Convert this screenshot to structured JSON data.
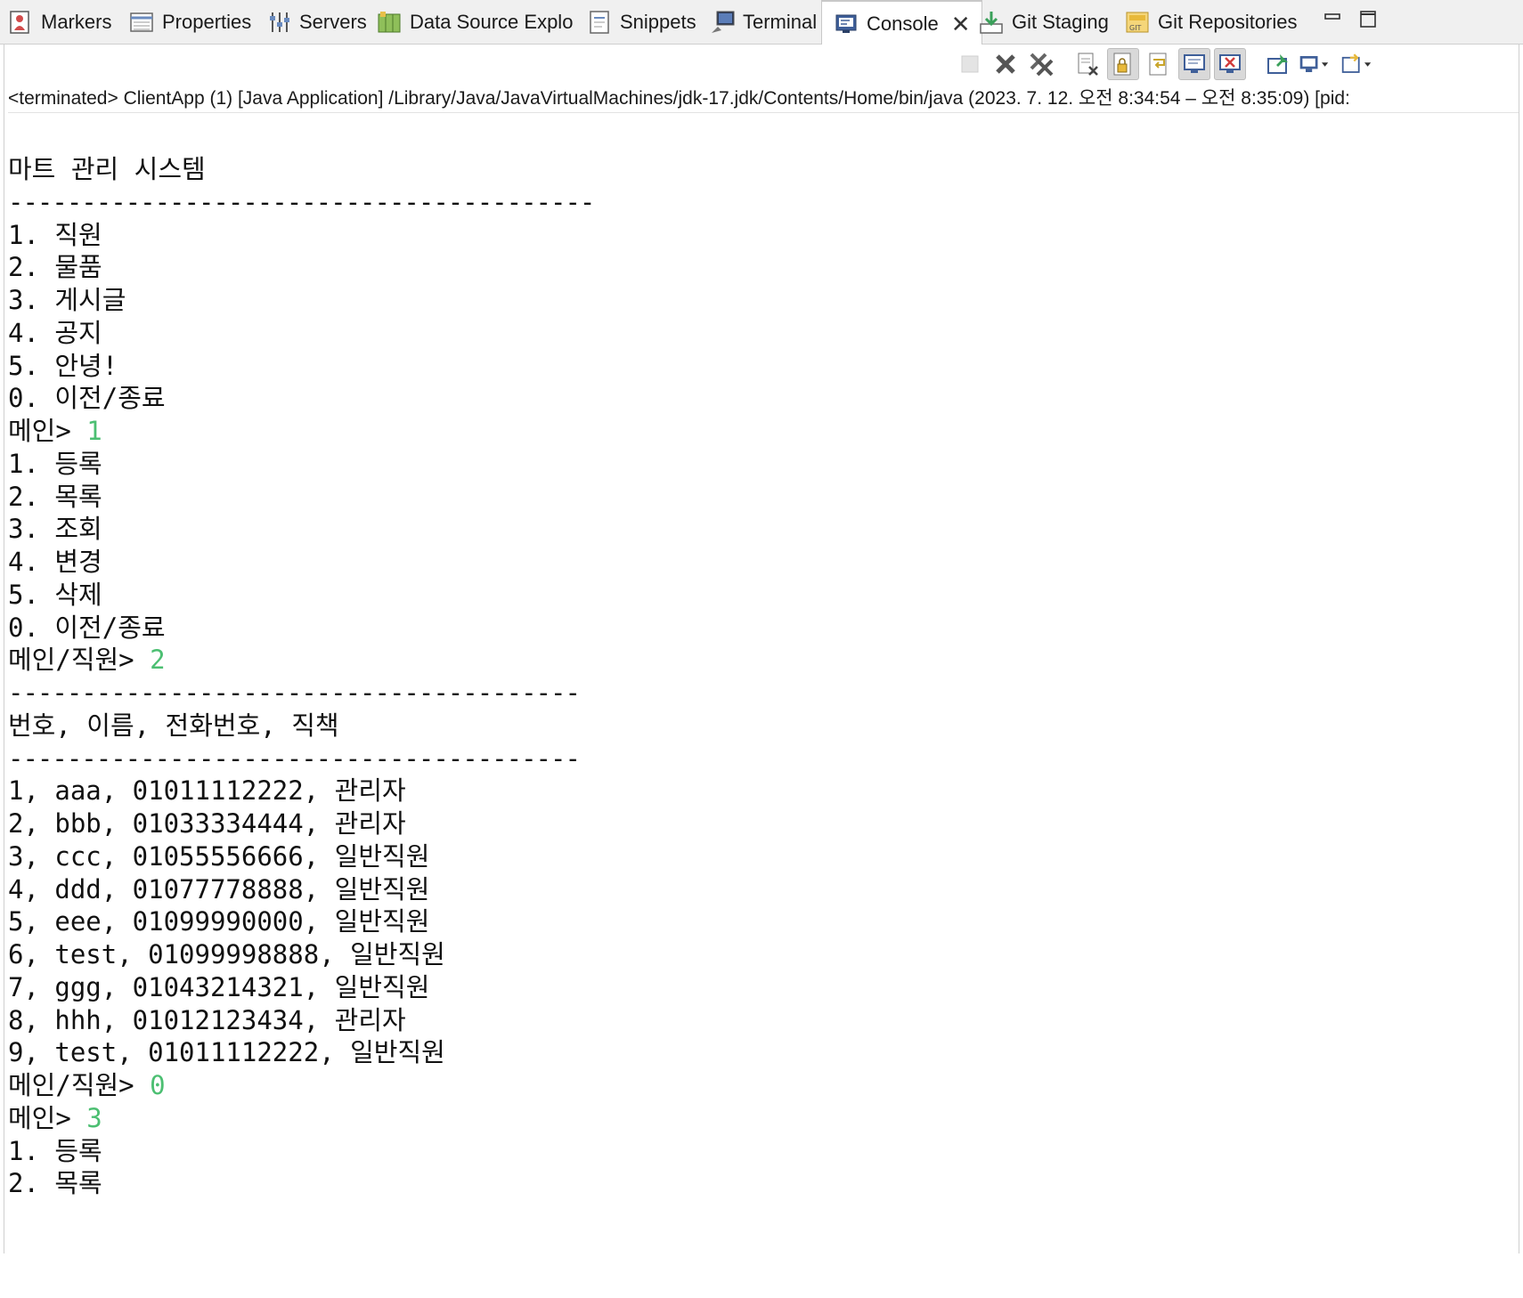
{
  "tabs": [
    {
      "label": "Markers",
      "icon": "markers-icon"
    },
    {
      "label": "Properties",
      "icon": "properties-icon"
    },
    {
      "label": "Servers",
      "icon": "servers-icon"
    },
    {
      "label": "Data Source Explo",
      "icon": "data-source-explorer-icon"
    },
    {
      "label": "Snippets",
      "icon": "snippets-icon"
    },
    {
      "label": "Terminal",
      "icon": "terminal-icon"
    },
    {
      "label": "Console",
      "icon": "console-icon",
      "active": true
    },
    {
      "label": "Git Staging",
      "icon": "git-staging-icon"
    },
    {
      "label": "Git Repositories",
      "icon": "git-repositories-icon"
    }
  ],
  "window_controls": [
    "minimize-icon",
    "maximize-icon"
  ],
  "toolbar_icons": [
    "terminate-icon",
    "remove-launch-icon",
    "remove-all-terminated-icon",
    "clear-console-icon",
    "scroll-lock-icon",
    "word-wrap-icon",
    "show-on-stdout-icon",
    "show-on-stderr-icon",
    "pin-console-icon",
    "display-selected-console-icon",
    "open-console-icon"
  ],
  "process_info": "<terminated> ClientApp (1) [Java Application] /Library/Java/JavaVirtualMachines/jdk-17.jdk/Contents/Home/bin/java  (2023. 7. 12. 오전 8:34:54 – 오전 8:35:09) [pid:",
  "colors": {
    "input_text": "#4cbf72",
    "tab_bar_bg": "#f0f0f0",
    "active_tab_bg": "#ffffff"
  },
  "console_lines": [
    {
      "text": "마트 관리 시스템"
    },
    {
      "text": "----------------------------------------"
    },
    {
      "text": "1. 직원"
    },
    {
      "text": "2. 물품"
    },
    {
      "text": "3. 게시글"
    },
    {
      "text": "4. 공지"
    },
    {
      "text": "5. 안녕!"
    },
    {
      "text": "0. 이전/종료"
    },
    {
      "text": "메인> ",
      "input": "1"
    },
    {
      "text": "1. 등록"
    },
    {
      "text": "2. 목록"
    },
    {
      "text": "3. 조회"
    },
    {
      "text": "4. 변경"
    },
    {
      "text": "5. 삭제"
    },
    {
      "text": "0. 이전/종료"
    },
    {
      "text": "메인/직원> ",
      "input": "2"
    },
    {
      "text": "---------------------------------------"
    },
    {
      "text": "번호, 이름, 전화번호, 직책"
    },
    {
      "text": "---------------------------------------"
    },
    {
      "text": "1, aaa, 01011112222, 관리자"
    },
    {
      "text": "2, bbb, 01033334444, 관리자"
    },
    {
      "text": "3, ccc, 01055556666, 일반직원"
    },
    {
      "text": "4, ddd, 01077778888, 일반직원"
    },
    {
      "text": "5, eee, 01099990000, 일반직원"
    },
    {
      "text": "6, test, 01099998888, 일반직원"
    },
    {
      "text": "7, ggg, 01043214321, 일반직원"
    },
    {
      "text": "8, hhh, 01012123434, 관리자"
    },
    {
      "text": "9, test, 01011112222, 일반직원"
    },
    {
      "text": "메인/직원> ",
      "input": "0"
    },
    {
      "text": "메인> ",
      "input": "3"
    },
    {
      "text": "1. 등록"
    },
    {
      "text": "2. 목록"
    }
  ]
}
